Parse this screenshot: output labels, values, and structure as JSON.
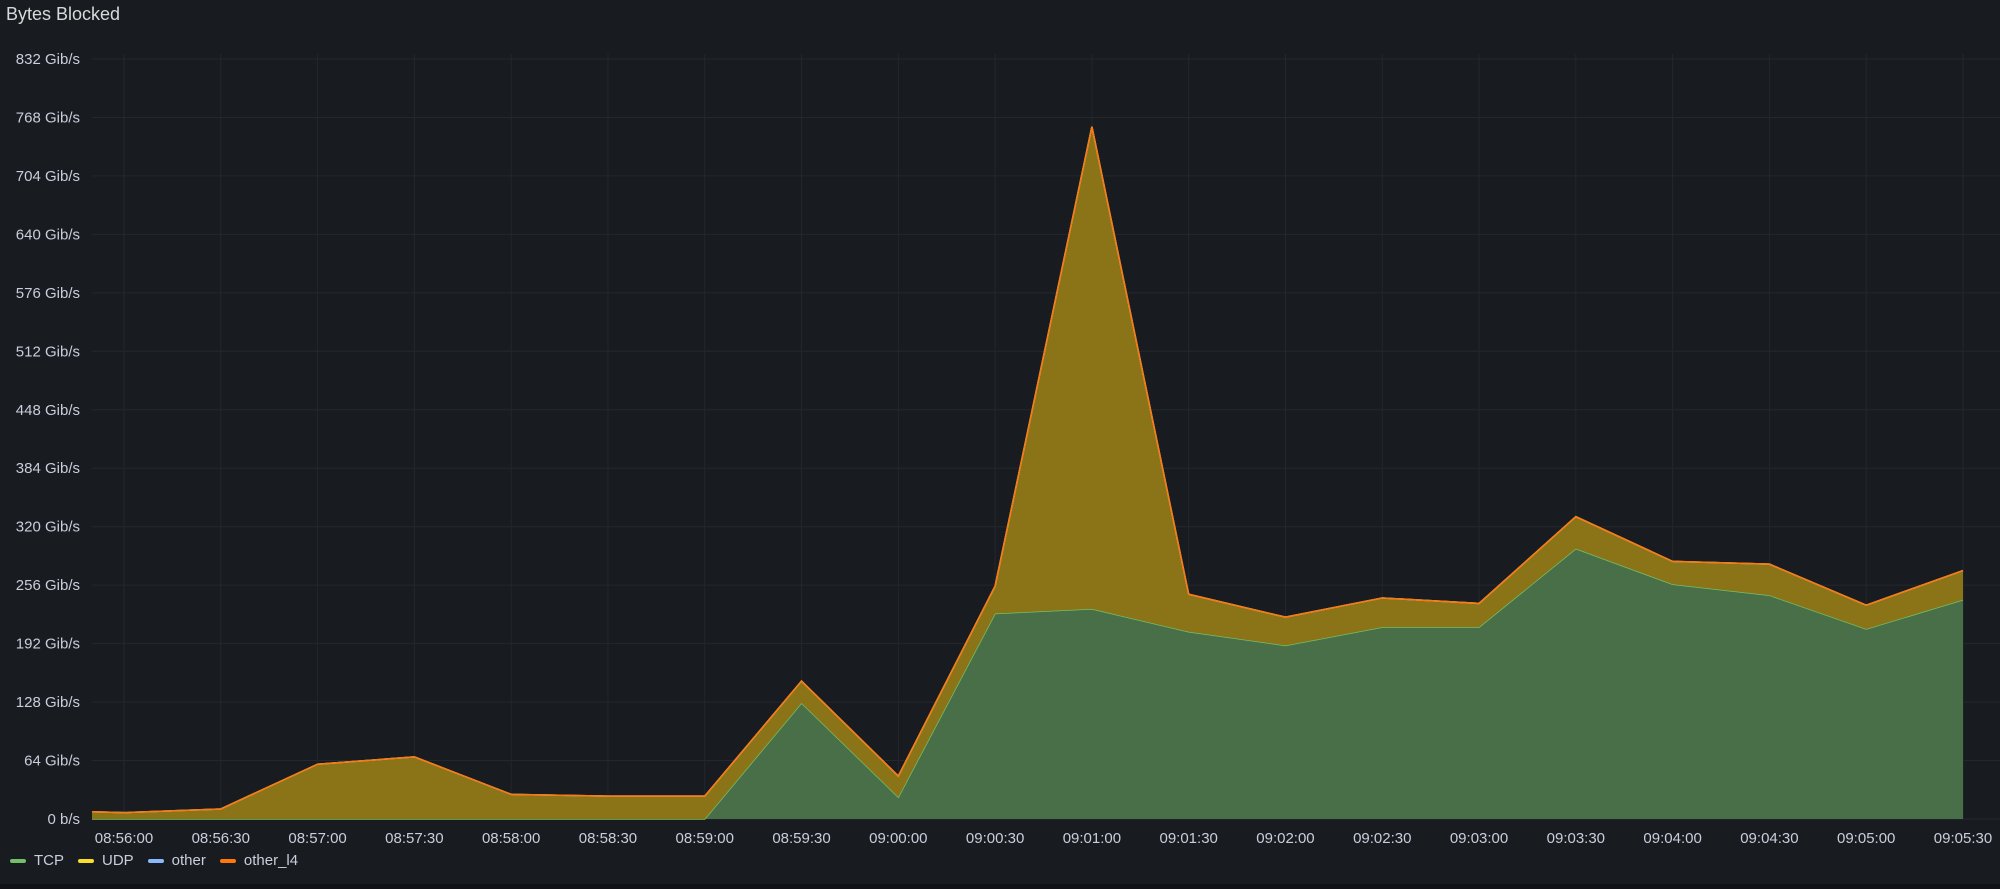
{
  "panel": {
    "title": "Bytes Blocked"
  },
  "legend": {
    "items": [
      {
        "label": "TCP",
        "color": "#73bf69"
      },
      {
        "label": "UDP",
        "color": "#fade2a"
      },
      {
        "label": "other",
        "color": "#8ab8ff"
      },
      {
        "label": "other_l4",
        "color": "#ff780a"
      }
    ]
  },
  "chart_data": {
    "type": "area",
    "stacked": true,
    "unit": "Gib/s",
    "ylim": [
      0,
      832
    ],
    "y_ticks": [
      {
        "value": 0,
        "label": "0 b/s"
      },
      {
        "value": 64,
        "label": "64 Gib/s"
      },
      {
        "value": 128,
        "label": "128 Gib/s"
      },
      {
        "value": 192,
        "label": "192 Gib/s"
      },
      {
        "value": 256,
        "label": "256 Gib/s"
      },
      {
        "value": 320,
        "label": "320 Gib/s"
      },
      {
        "value": 384,
        "label": "384 Gib/s"
      },
      {
        "value": 448,
        "label": "448 Gib/s"
      },
      {
        "value": 512,
        "label": "512 Gib/s"
      },
      {
        "value": 576,
        "label": "576 Gib/s"
      },
      {
        "value": 640,
        "label": "640 Gib/s"
      },
      {
        "value": 704,
        "label": "704 Gib/s"
      },
      {
        "value": 768,
        "label": "768 Gib/s"
      },
      {
        "value": 832,
        "label": "832 Gib/s"
      }
    ],
    "x_tick_labels": [
      "08:56:00",
      "08:56:30",
      "08:57:00",
      "08:57:30",
      "08:58:00",
      "08:58:30",
      "08:59:00",
      "08:59:30",
      "09:00:00",
      "09:00:30",
      "09:01:00",
      "09:01:30",
      "09:02:00",
      "09:02:30",
      "09:03:00",
      "09:03:30",
      "09:04:00",
      "09:04:30",
      "09:05:00",
      "09:05:30"
    ],
    "x": [
      "08:55:50",
      "08:56:00",
      "08:56:30",
      "08:57:00",
      "08:57:30",
      "08:58:00",
      "08:58:30",
      "08:59:00",
      "08:59:30",
      "09:00:00",
      "09:00:30",
      "09:01:00",
      "09:01:30",
      "09:02:00",
      "09:02:30",
      "09:03:00",
      "09:03:30",
      "09:04:00",
      "09:04:30",
      "09:05:00",
      "09:05:30"
    ],
    "grid": true,
    "legend_position": "bottom-left",
    "series": [
      {
        "name": "TCP",
        "color": "#73bf69",
        "values": [
          0,
          0,
          0,
          0,
          0,
          0,
          0,
          0,
          127,
          24,
          225,
          230,
          205,
          190,
          210,
          210,
          296,
          257,
          245,
          208,
          240
        ]
      },
      {
        "name": "UDP",
        "color": "#fade2a",
        "values": [
          8,
          7,
          11,
          60,
          68,
          27,
          25,
          25,
          24,
          23,
          30,
          528,
          41,
          31,
          32,
          26,
          35,
          25,
          34,
          26,
          32
        ]
      },
      {
        "name": "other",
        "color": "#8ab8ff",
        "values": [
          0,
          0,
          0,
          0,
          0,
          0,
          0,
          0,
          0,
          0,
          0,
          0,
          0,
          0,
          0,
          0,
          0,
          0,
          0,
          0,
          0
        ]
      },
      {
        "name": "other_l4",
        "color": "#ff780a",
        "values": [
          0,
          0,
          0,
          0,
          0,
          0,
          0,
          0,
          0,
          0,
          0,
          0,
          0,
          0,
          0,
          0,
          0,
          0,
          0,
          0,
          0
        ]
      }
    ]
  }
}
